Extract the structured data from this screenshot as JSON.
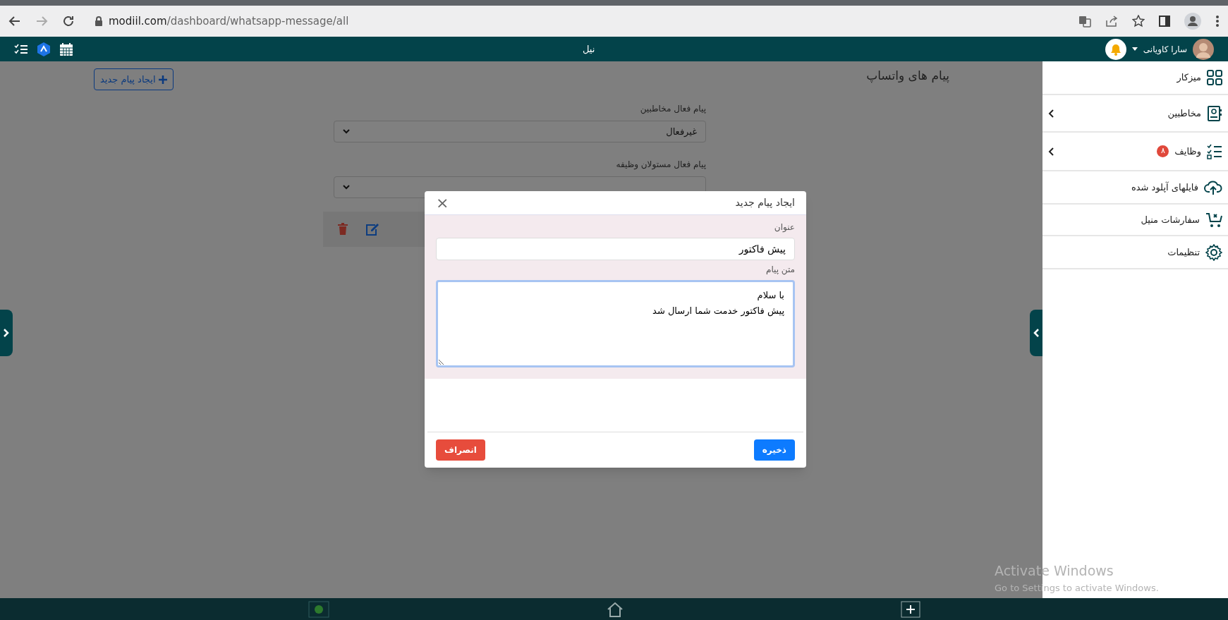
{
  "browser": {
    "url_host": "modiil.com",
    "url_path": "/dashboard/whatsapp-message/all"
  },
  "header": {
    "title": "نیل",
    "user_name": "سارا کاویانی"
  },
  "sidebar": {
    "items": [
      {
        "label": "میزکار",
        "has_submenu": false
      },
      {
        "label": "مخاطبین",
        "has_submenu": true
      },
      {
        "label": "وظایف",
        "has_submenu": true,
        "badge": "۸"
      },
      {
        "label": "فایلهای آپلود شده",
        "has_submenu": false
      },
      {
        "label": "سفارشات منیل",
        "has_submenu": false
      },
      {
        "label": "تنظیمات",
        "has_submenu": false
      }
    ]
  },
  "page": {
    "title": "پیام های واتساپ",
    "new_button": "ایجاد پیام جدید",
    "fields": [
      {
        "label": "پیام فعال مخاطبین",
        "value": "غیرفعال"
      },
      {
        "label": "پیام فعال مستولان وظیفه"
      }
    ]
  },
  "modal": {
    "title": "ایجاد پیام جدید",
    "close": "×",
    "fields": [
      {
        "kind": "input",
        "label": "عنوان",
        "value": "پیش فاکتور"
      },
      {
        "kind": "textarea",
        "label": "متن پیام",
        "value": "با سلام\nپیش فاکتور خدمت شما ارسال شد",
        "focused": true
      }
    ],
    "buttons": [
      {
        "kind": "primary",
        "label": "ذخیره"
      },
      {
        "kind": "danger",
        "label": "انصراف"
      }
    ]
  },
  "os_notice": {
    "title": "Activate Windows",
    "subtitle": "Go to Settings to activate Windows."
  }
}
